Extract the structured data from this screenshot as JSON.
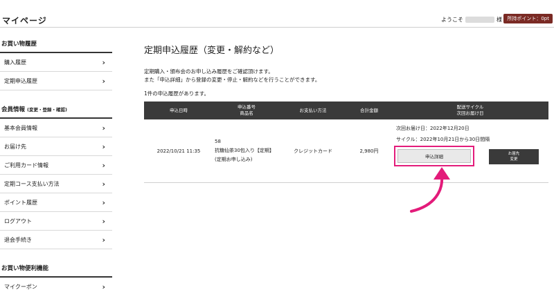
{
  "header": {
    "title": "マイページ",
    "welcome_prefix": "ようこそ",
    "welcome_suffix": "様",
    "points": "所持ポイント：0pt"
  },
  "sidebar": {
    "sections": [
      {
        "title": "お買い物履歴",
        "sub": "",
        "items": [
          "購入履歴",
          "定期申込履歴"
        ]
      },
      {
        "title": "会員情報",
        "sub": "(変更・登録・確認)",
        "items": [
          "基本会員情報",
          "お届け先",
          "ご利用カード情報",
          "定期コース支払い方法",
          "ポイント履歴",
          "ログアウト",
          "退会手続き"
        ]
      },
      {
        "title": "お買い物便利機能",
        "sub": "",
        "items": [
          "マイクーポン"
        ]
      }
    ]
  },
  "main": {
    "title": "定期申込履歴（変更・解約など）",
    "desc1": "定期購入・頒布会のお申し込み履歴をご確認頂けます。",
    "desc2": "また「申込詳細」から登録の変更・停止・解約などを行うことができます。",
    "count": "1件の申込履歴があります。"
  },
  "table": {
    "headers": {
      "date": "申込日時",
      "order_no": "申込番号",
      "product": "商品名",
      "payment": "お支払い方法",
      "total": "合計金額",
      "cycle": "配送サイクル",
      "next": "次回お届け日"
    },
    "row": {
      "date": "2022/10/21 11:35",
      "order_no": "58",
      "product": "抗糖仙茶30包入り【定期】",
      "product_note": "(定期お申し込み)",
      "payment": "クレジットカード",
      "total": "2,980円",
      "next_date": "次回お届け日：2022年12月20日",
      "cycle": "サイクル：2022年10月21日から30日間隔",
      "detail_btn": "申込詳細",
      "address_btn_l1": "お届先",
      "address_btn_l2": "変更"
    }
  },
  "colors": {
    "badge": "#7a2a24",
    "header_bg": "#3a3a3a",
    "highlight": "#e31b7a"
  },
  "icons": {
    "chevron": "chevron-right-icon",
    "arrow": "pink-curved-arrow-icon"
  }
}
